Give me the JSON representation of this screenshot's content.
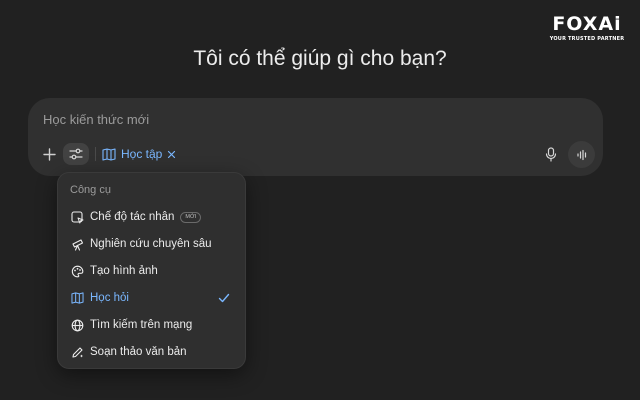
{
  "brand": {
    "logo_text": "FOXAi",
    "tagline": "YOUR TRUSTED PARTNER"
  },
  "headline": "Tôi có thể giúp gì cho bạn?",
  "composer": {
    "placeholder": "Học kiến thức mới",
    "active_tool_chip": "Học tập",
    "icons": [
      "plus-icon",
      "sliders-icon",
      "book-icon",
      "close-icon",
      "microphone-icon",
      "voice-wave-icon"
    ]
  },
  "tools_menu": {
    "heading": "Công cụ",
    "items": [
      {
        "label": "Chế độ tác nhân",
        "icon": "agent-icon",
        "badge": "MỚI",
        "selected": false
      },
      {
        "label": "Nghiên cứu chuyên sâu",
        "icon": "telescope-icon",
        "selected": false
      },
      {
        "label": "Tạo hình ảnh",
        "icon": "palette-icon",
        "selected": false
      },
      {
        "label": "Học hỏi",
        "icon": "book-icon",
        "selected": true
      },
      {
        "label": "Tìm kiếm trên mạng",
        "icon": "globe-icon",
        "selected": false
      },
      {
        "label": "Soạn thảo văn bản",
        "icon": "pen-icon",
        "selected": false
      }
    ]
  },
  "colors": {
    "background": "#212121",
    "composer": "#303030",
    "accent": "#7ab7ff",
    "menu": "#2f2f2f"
  }
}
